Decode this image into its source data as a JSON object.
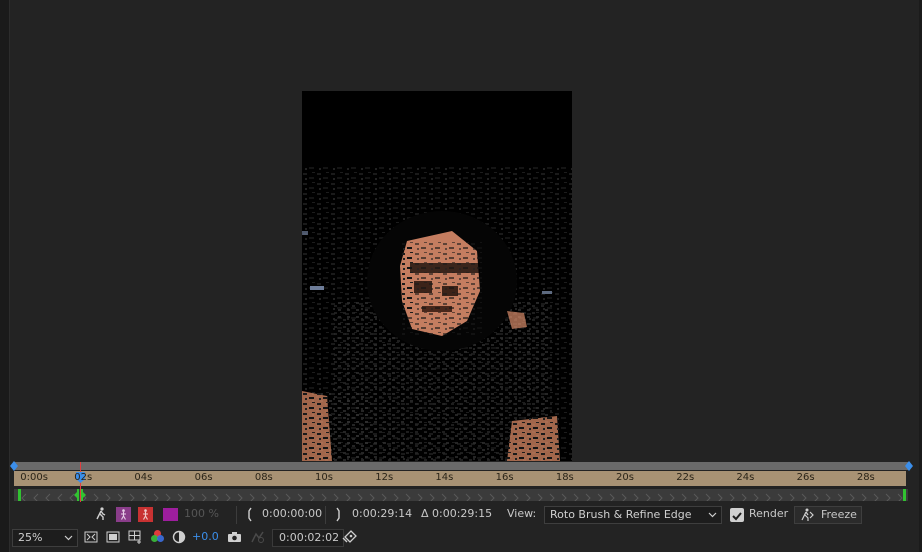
{
  "timeline": {
    "ticks": [
      "0:00s",
      "02s",
      "04s",
      "06s",
      "08s",
      "10s",
      "12s",
      "14s",
      "16s",
      "18s",
      "20s",
      "22s",
      "24s",
      "26s",
      "28s"
    ],
    "playhead_fraction": 0.068
  },
  "toolbar": {
    "opacity": "100 %",
    "span_start": "0:00:00:00",
    "span_end": "0:00:29:14",
    "span_duration": "Δ 0:00:29:15",
    "view_label": "View:",
    "view_value": "Roto Brush & Refine Edge",
    "render_label": "Render",
    "freeze_label": "Freeze"
  },
  "viewer_controls": {
    "zoom": "25%",
    "exposure": "+0.0",
    "timecode": "0:00:02:02"
  },
  "colors": {
    "accent_blue": "#3b8eea",
    "ruler": "#a89274",
    "keyframe_green": "#31c231",
    "playhead_red": "#e04040",
    "swatch_purple": "#8a3d8a",
    "swatch_red": "#c83232",
    "swatch_magenta": "#9e1e9e"
  }
}
